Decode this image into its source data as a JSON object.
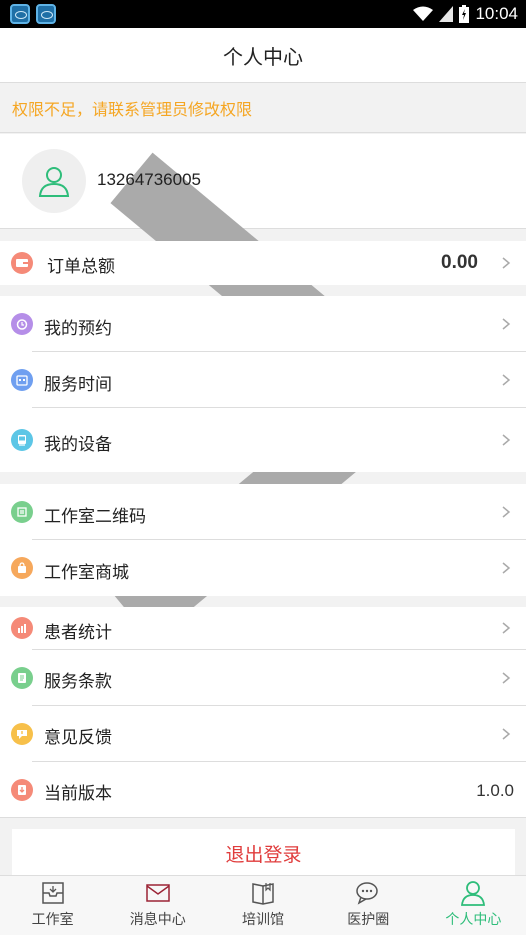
{
  "status_bar": {
    "time": "10:04"
  },
  "header": {
    "title": "个人中心"
  },
  "notice": {
    "text": "权限不足，请联系管理员修改权限"
  },
  "profile": {
    "phone": "13264736005"
  },
  "rows": [
    {
      "label": "订单总额",
      "value": "0.00",
      "icon": "wallet-icon",
      "color": "#f58a78"
    },
    {
      "label": "我的预约",
      "icon": "alarm-clock-icon",
      "color": "#b58ee8"
    },
    {
      "label": "服务时间",
      "icon": "calendar-icon",
      "color": "#6f9ff0"
    },
    {
      "label": "我的设备",
      "icon": "device-icon",
      "color": "#5cc6e6"
    },
    {
      "label": "工作室二维码",
      "icon": "qrcode-icon",
      "color": "#79cf8d"
    },
    {
      "label": "工作室商城",
      "icon": "shopping-bag-icon",
      "color": "#f6a85c"
    },
    {
      "label": "患者统计",
      "icon": "bar-chart-icon",
      "color": "#f58a78"
    },
    {
      "label": "服务条款",
      "icon": "document-icon",
      "color": "#79cf8d"
    },
    {
      "label": "意见反馈",
      "icon": "feedback-icon",
      "color": "#f7c04a"
    },
    {
      "label": "当前版本",
      "value": "1.0.0",
      "icon": "download-icon",
      "color": "#f58a78"
    }
  ],
  "logout": {
    "label": "退出登录"
  },
  "tabs": [
    {
      "label": "工作室",
      "icon": "home-box-icon"
    },
    {
      "label": "消息中心",
      "icon": "envelope-icon"
    },
    {
      "label": "培训馆",
      "icon": "book-icon"
    },
    {
      "label": "医护圈",
      "icon": "chat-bubble-icon"
    },
    {
      "label": "个人中心",
      "icon": "person-icon",
      "active": true
    }
  ],
  "colors": {
    "accent": "#2ebd7a",
    "warning": "#f5a623",
    "danger": "#e03c3c"
  }
}
